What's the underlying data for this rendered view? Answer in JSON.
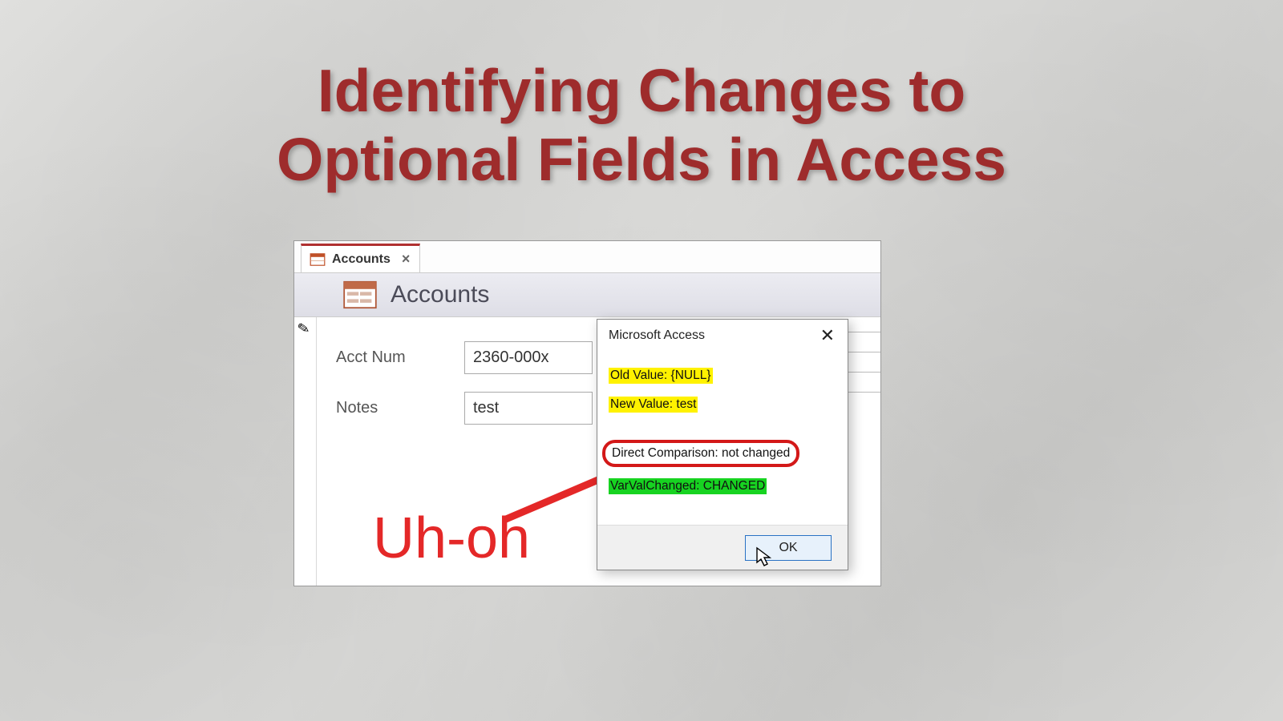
{
  "page": {
    "title_line1": "Identifying Changes to",
    "title_line2": "Optional Fields in Access"
  },
  "window": {
    "tab_label": "Accounts",
    "header_title": "Accounts",
    "form": {
      "fields": [
        {
          "label": "Acct Num",
          "value": "2360-000x"
        },
        {
          "label": "Notes",
          "value": "test"
        }
      ]
    },
    "exclamation": "Uh-oh"
  },
  "dialog": {
    "title": "Microsoft Access",
    "lines": {
      "old_value": "Old Value: {NULL}",
      "new_value": "New Value: test",
      "direct": "Direct Comparison: not changed",
      "varval": "VarValChanged: CHANGED"
    },
    "ok_label": "OK"
  },
  "icons": {
    "form_icon": "form-icon",
    "close_icon": "close-icon",
    "pencil_icon": "pencil-icon",
    "cursor_icon": "cursor-icon"
  },
  "colors": {
    "title": "#9e2c2c",
    "accent_red": "#d31818",
    "highlight_yellow": "#fff200",
    "highlight_green": "#17d321",
    "ok_border": "#2a72c4"
  }
}
